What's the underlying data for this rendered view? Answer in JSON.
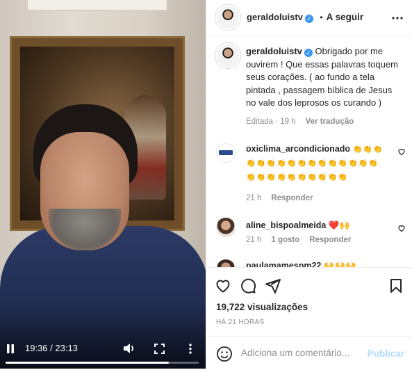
{
  "video": {
    "current_time": "19:36",
    "duration": "23:13",
    "time_label": "19:36 / 23:13",
    "progress": 0.844,
    "icons": {
      "play_pause": "pause-icon",
      "volume": "volume-icon",
      "fullscreen": "fullscreen-icon",
      "more": "more-vertical-icon"
    }
  },
  "header": {
    "username": "geraldoluistv",
    "separator": "•",
    "follow_label": "A seguir",
    "more_icon": "more-horizontal-icon"
  },
  "caption": {
    "username": "geraldoluistv",
    "text": "Obrigado por me ouvirem ! Que essas palavras toquem seus corações. ( ao fundo a tela pintada , passagem bíblica de Jesus no vale dos leprosos os curando )",
    "edited": "Editada · 19 h",
    "translate": "Ver tradução"
  },
  "comments": [
    {
      "username": "oxiclima_arcondicionado",
      "text": "👏👏👏👏👏👏👏👏👏👏👏👏👏👏👏👏👏👏👏👏👏👏👏👏👏👏",
      "time": "21 h",
      "likes": "",
      "reply": "Responder"
    },
    {
      "username": "aline_bispoalmeida",
      "text": "❤️🙌",
      "time": "21 h",
      "likes": "1 gosto",
      "reply": "Responder"
    },
    {
      "username": "paulamamespm22",
      "text": "🙌🙌🙌"
    }
  ],
  "actions": {
    "like_icon": "heart-icon",
    "comment_icon": "comment-icon",
    "share_icon": "share-icon",
    "save_icon": "bookmark-icon"
  },
  "stats": {
    "views": "19,722 visualizações",
    "ago": "HÁ 21 HORAS"
  },
  "add_comment": {
    "placeholder": "Adiciona um comentário...",
    "publish": "Publicar"
  },
  "colors": {
    "verified": "#3897f0",
    "publish_disabled": "#b3dbff",
    "text": "#262626",
    "secondary": "#8e8e8e"
  }
}
